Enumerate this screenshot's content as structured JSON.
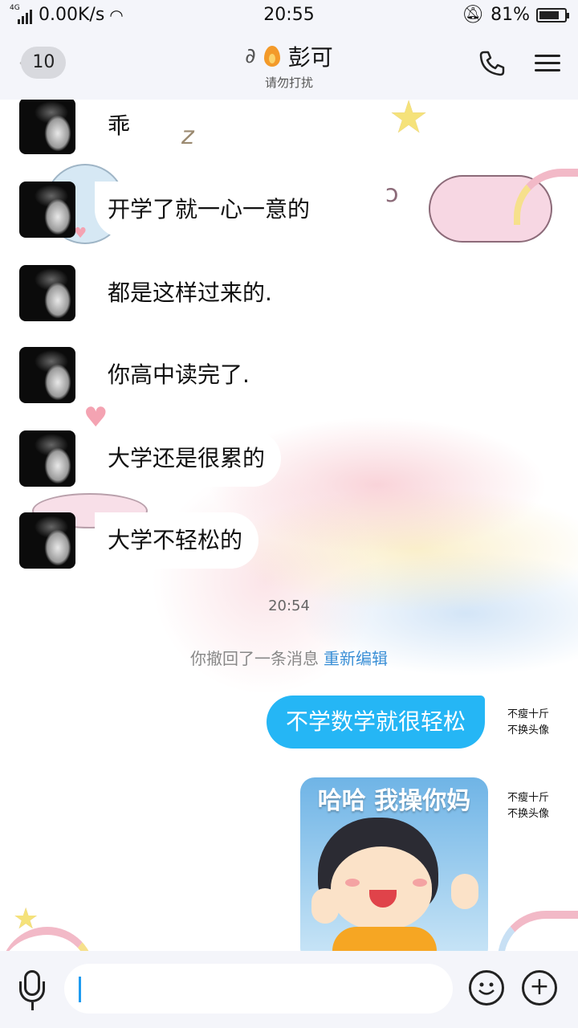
{
  "status_bar": {
    "network": "4G",
    "speed": "0.00K/s",
    "time": "20:55",
    "battery": "81%",
    "battery_level": 0.81
  },
  "header": {
    "back_count": "10",
    "title": "彭可",
    "subtitle": "请勿打扰"
  },
  "messages_in": [
    {
      "text": "乖",
      "bubble": false
    },
    {
      "text": "开学了就一心一意的",
      "bubble": true
    },
    {
      "text": "都是这样过来的.",
      "bubble": false
    },
    {
      "text": "你高中读完了.",
      "bubble": false
    },
    {
      "text": "大学还是很累的",
      "bubble": true
    },
    {
      "text": "大学不轻松的",
      "bubble": true
    }
  ],
  "timestamp": "20:54",
  "recall": {
    "text": "你撤回了一条消息",
    "link": "重新编辑"
  },
  "self": {
    "name_line1": "不瘦十斤",
    "name_line2": "不换头像"
  },
  "messages_out": [
    {
      "text": "不学数学就很轻松"
    }
  ],
  "sticker": {
    "caption": "哈哈 我操你妈"
  },
  "colors": {
    "accent": "#25b6f5",
    "link": "#3a8fd6"
  },
  "icons": [
    "microphone-icon",
    "emoji-icon",
    "plus-icon",
    "phone-icon",
    "menu-icon",
    "ear-icon",
    "flame-icon",
    "wifi-icon",
    "mute-bell-icon",
    "battery-icon"
  ]
}
